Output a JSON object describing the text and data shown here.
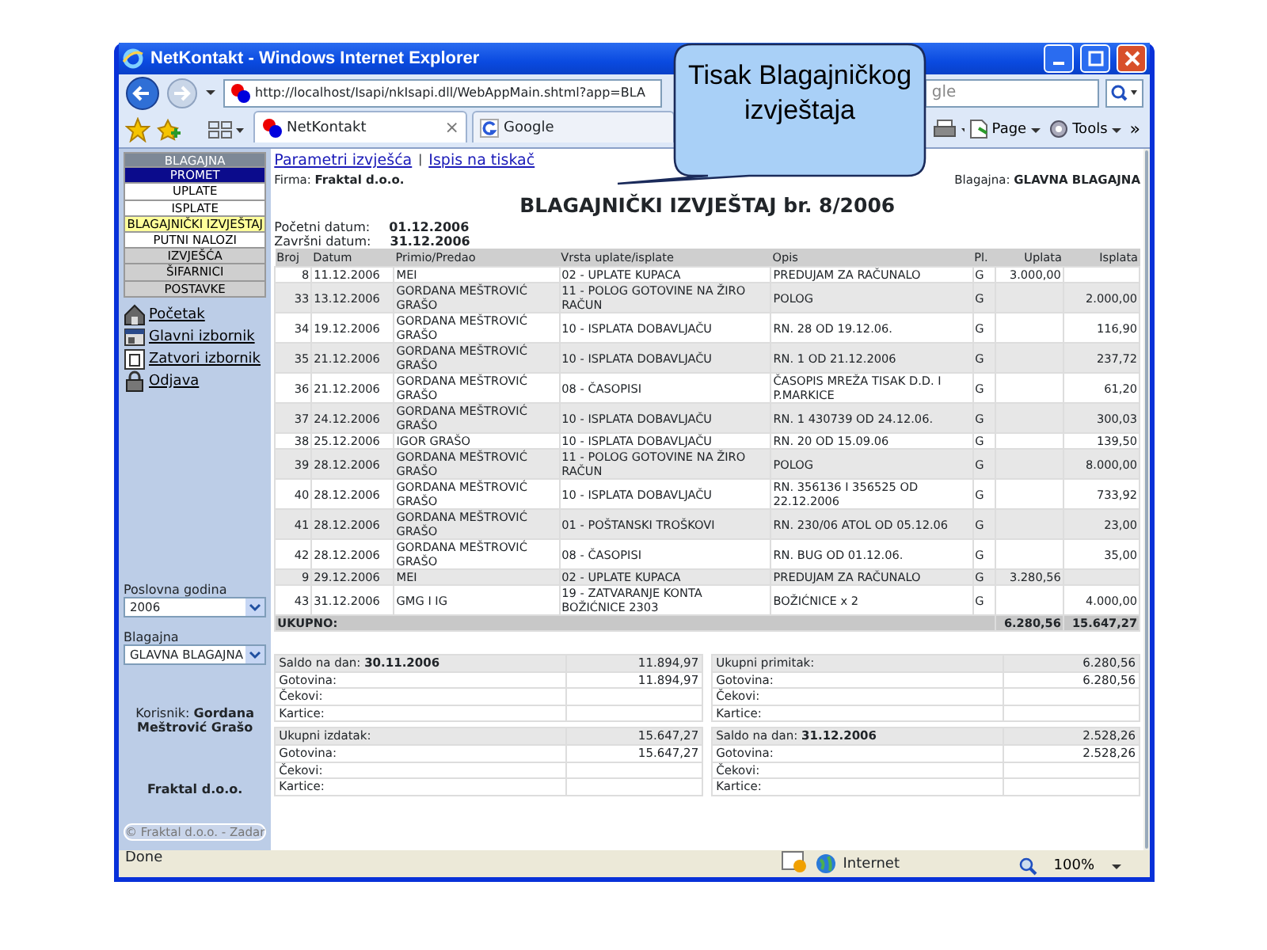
{
  "browser": {
    "title": "NetKontakt - Windows Internet Explorer",
    "address": "http://localhost/Isapi/nkIsapi.dll/WebAppMain.shtml?app=BLA",
    "search_text": "gle",
    "tabs": [
      {
        "label": "NetKontakt",
        "selected": true,
        "close": "×"
      },
      {
        "label": "Google",
        "selected": false
      }
    ],
    "commands": [
      {
        "label": "Page",
        "kind": "page"
      },
      {
        "label": "Tools",
        "kind": "tools"
      }
    ],
    "more": "»"
  },
  "callout": {
    "text": "Tisak Blagajničkog izvještaja"
  },
  "sidebar": {
    "menu": [
      {
        "label": "BLAGAJNA",
        "kind": "header"
      },
      {
        "label": "PROMET",
        "kind": "section",
        "selected": true
      },
      {
        "label": "UPLATE",
        "kind": "item",
        "selected": false
      },
      {
        "label": "ISPLATE",
        "kind": "item",
        "selected": false
      },
      {
        "label": "BLAGAJNIČKI IZVJEŠTAJ",
        "kind": "item",
        "selected": true
      },
      {
        "label": "PUTNI NALOZI",
        "kind": "item",
        "selected": false
      },
      {
        "label": "IZVJEŠĆA",
        "kind": "section",
        "selected": false
      },
      {
        "label": "ŠIFARNICI",
        "kind": "section",
        "selected": false
      },
      {
        "label": "POSTAVKE",
        "kind": "section",
        "selected": false
      }
    ],
    "links": [
      {
        "label": "Početak",
        "kind": "home"
      },
      {
        "label": "Glavni izbornik",
        "kind": "main"
      },
      {
        "label": "Zatvori izbornik",
        "kind": "close"
      },
      {
        "label": "Odjava",
        "kind": "logout"
      }
    ],
    "fields": [
      {
        "label": "Poslovna godina",
        "value": "2006"
      },
      {
        "label": "Blagajna",
        "value": "GLAVNA BLAGAJNA"
      }
    ],
    "user": "Korisnik: **Gordana Meštrović Grašo**",
    "company": "Fraktal d.o.o.",
    "footer": "© Fraktal d.o.o. - Zadar"
  },
  "report": {
    "links": [
      "Parametri izvješća",
      "Ispis na tiskač"
    ],
    "separator": "|",
    "firm": "Firma: **Fraktal d.o.o.**",
    "cashbox": "Blagajna: **GLAVNA BLAGAJNA**",
    "title": "BLAGAJNIČKI IZVJEŠTAJ br. 8/2006",
    "dates": [
      {
        "label": "Početni datum:",
        "value": "01.12.2006"
      },
      {
        "label": "Završni datum:",
        "value": "31.12.2006"
      }
    ],
    "columns": [
      "Broj",
      "Datum",
      "Primio/Predao",
      "Vrsta uplate/isplate",
      "Opis",
      "Pl.",
      "Uplata",
      "Isplata"
    ],
    "rows": [
      {
        "broj": "8",
        "datum": "11.12.2006",
        "primio": "MEI",
        "vrsta": "02 - UPLATE KUPACA",
        "opis": "PREDUJAM ZA RAČUNALO",
        "pl": "G",
        "uplata": "3.000,00"
      },
      {
        "broj": "33",
        "datum": "13.12.2006",
        "primio": "GORDANA MEŠTROVIĆ GRAŠO",
        "vrsta": "11 - POLOG GOTOVINE NA ŽIRO RAČUN",
        "opis": "POLOG",
        "pl": "G",
        "isplata": "2.000,00"
      },
      {
        "broj": "34",
        "datum": "19.12.2006",
        "primio": "GORDANA MEŠTROVIĆ GRAŠO",
        "vrsta": "10 - ISPLATA DOBAVLJAČU",
        "opis": "RN. 28 OD 19.12.06.",
        "pl": "G",
        "isplata": "116,90"
      },
      {
        "broj": "35",
        "datum": "21.12.2006",
        "primio": "GORDANA MEŠTROVIĆ GRAŠO",
        "vrsta": "10 - ISPLATA DOBAVLJAČU",
        "opis": "RN. 1 OD 21.12.2006",
        "pl": "G",
        "isplata": "237,72"
      },
      {
        "broj": "36",
        "datum": "21.12.2006",
        "primio": "GORDANA MEŠTROVIĆ GRAŠO",
        "vrsta": "08 - ČASOPISI",
        "opis": "ČASOPIS MREŽA TISAK D.D. I P.MARKICE",
        "pl": "G",
        "isplata": "61,20"
      },
      {
        "broj": "37",
        "datum": "24.12.2006",
        "primio": "GORDANA MEŠTROVIĆ GRAŠO",
        "vrsta": "10 - ISPLATA DOBAVLJAČU",
        "opis": "RN. 1 430739 OD 24.12.06.",
        "pl": "G",
        "isplata": "300,03"
      },
      {
        "broj": "38",
        "datum": "25.12.2006",
        "primio": "IGOR GRAŠO",
        "vrsta": "10 - ISPLATA DOBAVLJAČU",
        "opis": "RN. 20 OD 15.09.06",
        "pl": "G",
        "isplata": "139,50"
      },
      {
        "broj": "39",
        "datum": "28.12.2006",
        "primio": "GORDANA MEŠTROVIĆ GRAŠO",
        "vrsta": "11 - POLOG GOTOVINE NA ŽIRO RAČUN",
        "opis": "POLOG",
        "pl": "G",
        "isplata": "8.000,00"
      },
      {
        "broj": "40",
        "datum": "28.12.2006",
        "primio": "GORDANA MEŠTROVIĆ GRAŠO",
        "vrsta": "10 - ISPLATA DOBAVLJAČU",
        "opis": "RN. 356136 I 356525 OD 22.12.2006",
        "pl": "G",
        "isplata": "733,92"
      },
      {
        "broj": "41",
        "datum": "28.12.2006",
        "primio": "GORDANA MEŠTROVIĆ GRAŠO",
        "vrsta": "01 - POŠTANSKI TROŠKOVI",
        "opis": "RN. 230/06 ATOL OD 05.12.06",
        "pl": "G",
        "isplata": "23,00"
      },
      {
        "broj": "42",
        "datum": "28.12.2006",
        "primio": "GORDANA MEŠTROVIĆ GRAŠO",
        "vrsta": "08 - ČASOPISI",
        "opis": "RN. BUG OD 01.12.06.",
        "pl": "G",
        "isplata": "35,00"
      },
      {
        "broj": "9",
        "datum": "29.12.2006",
        "primio": "MEI",
        "vrsta": "02 - UPLATE KUPACA",
        "opis": "PREDUJAM ZA RAČUNALO",
        "pl": "G",
        "uplata": "3.280,56"
      },
      {
        "broj": "43",
        "datum": "31.12.2006",
        "primio": "GMG I IG",
        "vrsta": "19 - ZATVARANJE KONTA BOŽIĆNICE 2303",
        "opis": "BOŽIĆNICE x 2",
        "pl": "G",
        "isplata": "4.000,00"
      }
    ],
    "total": {
      "label": "UKUPNO:",
      "uplata": "6.280,56",
      "isplata": "15.647,27"
    },
    "summary": [
      {
        "rows": [
          {
            "label": "Saldo na dan: **30.11.2006**",
            "value": "11.894,97"
          },
          {
            "label": "Gotovina:",
            "value": "11.894,97"
          },
          {
            "label": "Čekovi:"
          },
          {
            "label": "Kartice:"
          }
        ]
      },
      {
        "rows": [
          {
            "label": "Ukupni primitak:",
            "value": "6.280,56"
          },
          {
            "label": "Gotovina:",
            "value": "6.280,56"
          },
          {
            "label": "Čekovi:"
          },
          {
            "label": "Kartice:"
          }
        ]
      },
      {
        "rows": [
          {
            "label": "Ukupni izdatak:",
            "value": "15.647,27"
          },
          {
            "label": "Gotovina:",
            "value": "15.647,27"
          },
          {
            "label": "Čekovi:"
          },
          {
            "label": "Kartice:"
          }
        ]
      },
      {
        "rows": [
          {
            "label": "Saldo na dan: **31.12.2006**",
            "value": "2.528,26"
          },
          {
            "label": "Gotovina:",
            "value": "2.528,26"
          },
          {
            "label": "Čekovi:"
          },
          {
            "label": "Kartice:"
          }
        ]
      }
    ]
  },
  "status_bar": {
    "text": "Done",
    "zone": "Internet",
    "zoom": "100%"
  }
}
